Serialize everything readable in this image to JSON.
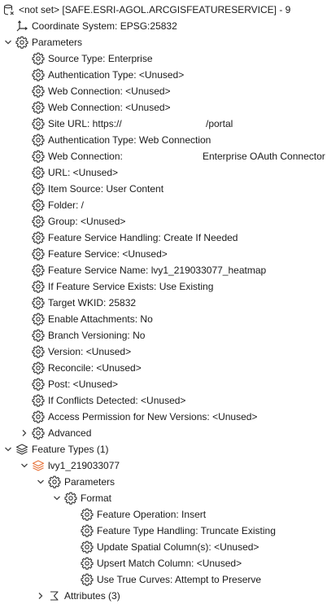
{
  "root": {
    "label": "<not set> [SAFE.ESRI-AGOL.ARCGISFEATURESERVICE] - 9",
    "icon": "database-icon"
  },
  "coordinate_system": {
    "label": "Coordinate System: EPSG:25832",
    "icon": "axes-icon"
  },
  "parameters": {
    "label": "Parameters",
    "icon": "gear-icon",
    "items": [
      {
        "label": "Source Type: Enterprise"
      },
      {
        "label": "Authentication Type: <Unused>"
      },
      {
        "label": "Web Connection: <Unused>"
      },
      {
        "label": "Web Connection: <Unused>"
      },
      {
        "label": "Site URL: https://",
        "suffix": "/portal"
      },
      {
        "label": "Authentication Type: Web Connection"
      },
      {
        "label": "Web Connection:",
        "suffix": "Enterprise OAuth Connector"
      },
      {
        "label": "URL: <Unused>"
      },
      {
        "label": "Item Source: User Content"
      },
      {
        "label": "Folder: /"
      },
      {
        "label": "Group: <Unused>"
      },
      {
        "label": "Feature Service Handling: Create If Needed"
      },
      {
        "label": "Feature Service: <Unused>"
      },
      {
        "label": "Feature Service Name: lvy1_219033077_heatmap"
      },
      {
        "label": "If Feature Service Exists: Use Existing"
      },
      {
        "label": "Target WKID: 25832"
      },
      {
        "label": "Enable Attachments: No"
      },
      {
        "label": "Branch Versioning: No"
      },
      {
        "label": "Version: <Unused>"
      },
      {
        "label": "Reconcile: <Unused>"
      },
      {
        "label": "Post: <Unused>"
      },
      {
        "label": "If Conflicts Detected: <Unused>"
      },
      {
        "label": "Access Permission for New Versions: <Unused>"
      }
    ],
    "advanced": {
      "label": "Advanced"
    }
  },
  "feature_types": {
    "label": "Feature Types (1)",
    "icon": "layers-icon",
    "feature_type": {
      "label": "lvy1_219033077",
      "icon": "orange-layers-icon",
      "parameters_label": "Parameters",
      "format_label": "Format",
      "format_items": [
        {
          "label": "Feature Operation: Insert"
        },
        {
          "label": "Feature Type Handling: Truncate Existing"
        },
        {
          "label": "Update Spatial Column(s): <Unused>"
        },
        {
          "label": "Upsert Match Column: <Unused>"
        },
        {
          "label": "Use True Curves: Attempt to Preserve"
        }
      ],
      "attributes_label": "Attributes (3)"
    }
  },
  "colors": {
    "text": "#1a1a1a",
    "icon_stroke": "#333333",
    "feature_type_accent": "#e8743b"
  }
}
